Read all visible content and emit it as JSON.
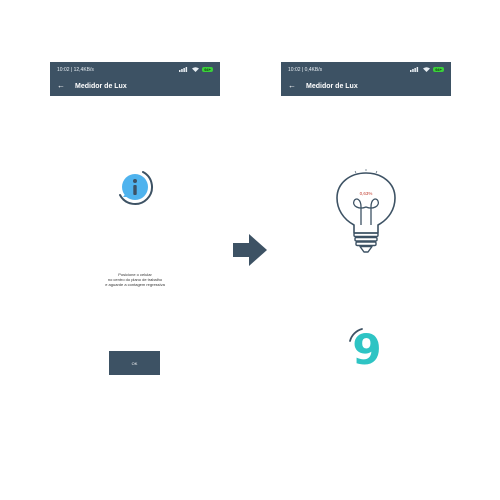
{
  "screens": [
    {
      "status_time": "10:02 | 12,4KB/s",
      "app_title": "Medidor de Lux",
      "instructions": [
        "Posicione o celular",
        "no centro do plano de trabalho",
        "e aguarde a contagem regressiva"
      ],
      "ok_label": "OK"
    },
    {
      "status_time": "10:02 | 0,4KB/s",
      "app_title": "Medidor de Lux",
      "bulb_percent": "0,63%",
      "countdown": "9"
    }
  ],
  "battery_label": "94+",
  "colors": {
    "appbar": "#3d5264",
    "accent": "#2ec4c4",
    "info": "#4fb3ee",
    "arrow": "#3d5264"
  },
  "icons": [
    "back-arrow-icon",
    "info-icon",
    "next-arrow-icon",
    "light-bulb-icon"
  ]
}
